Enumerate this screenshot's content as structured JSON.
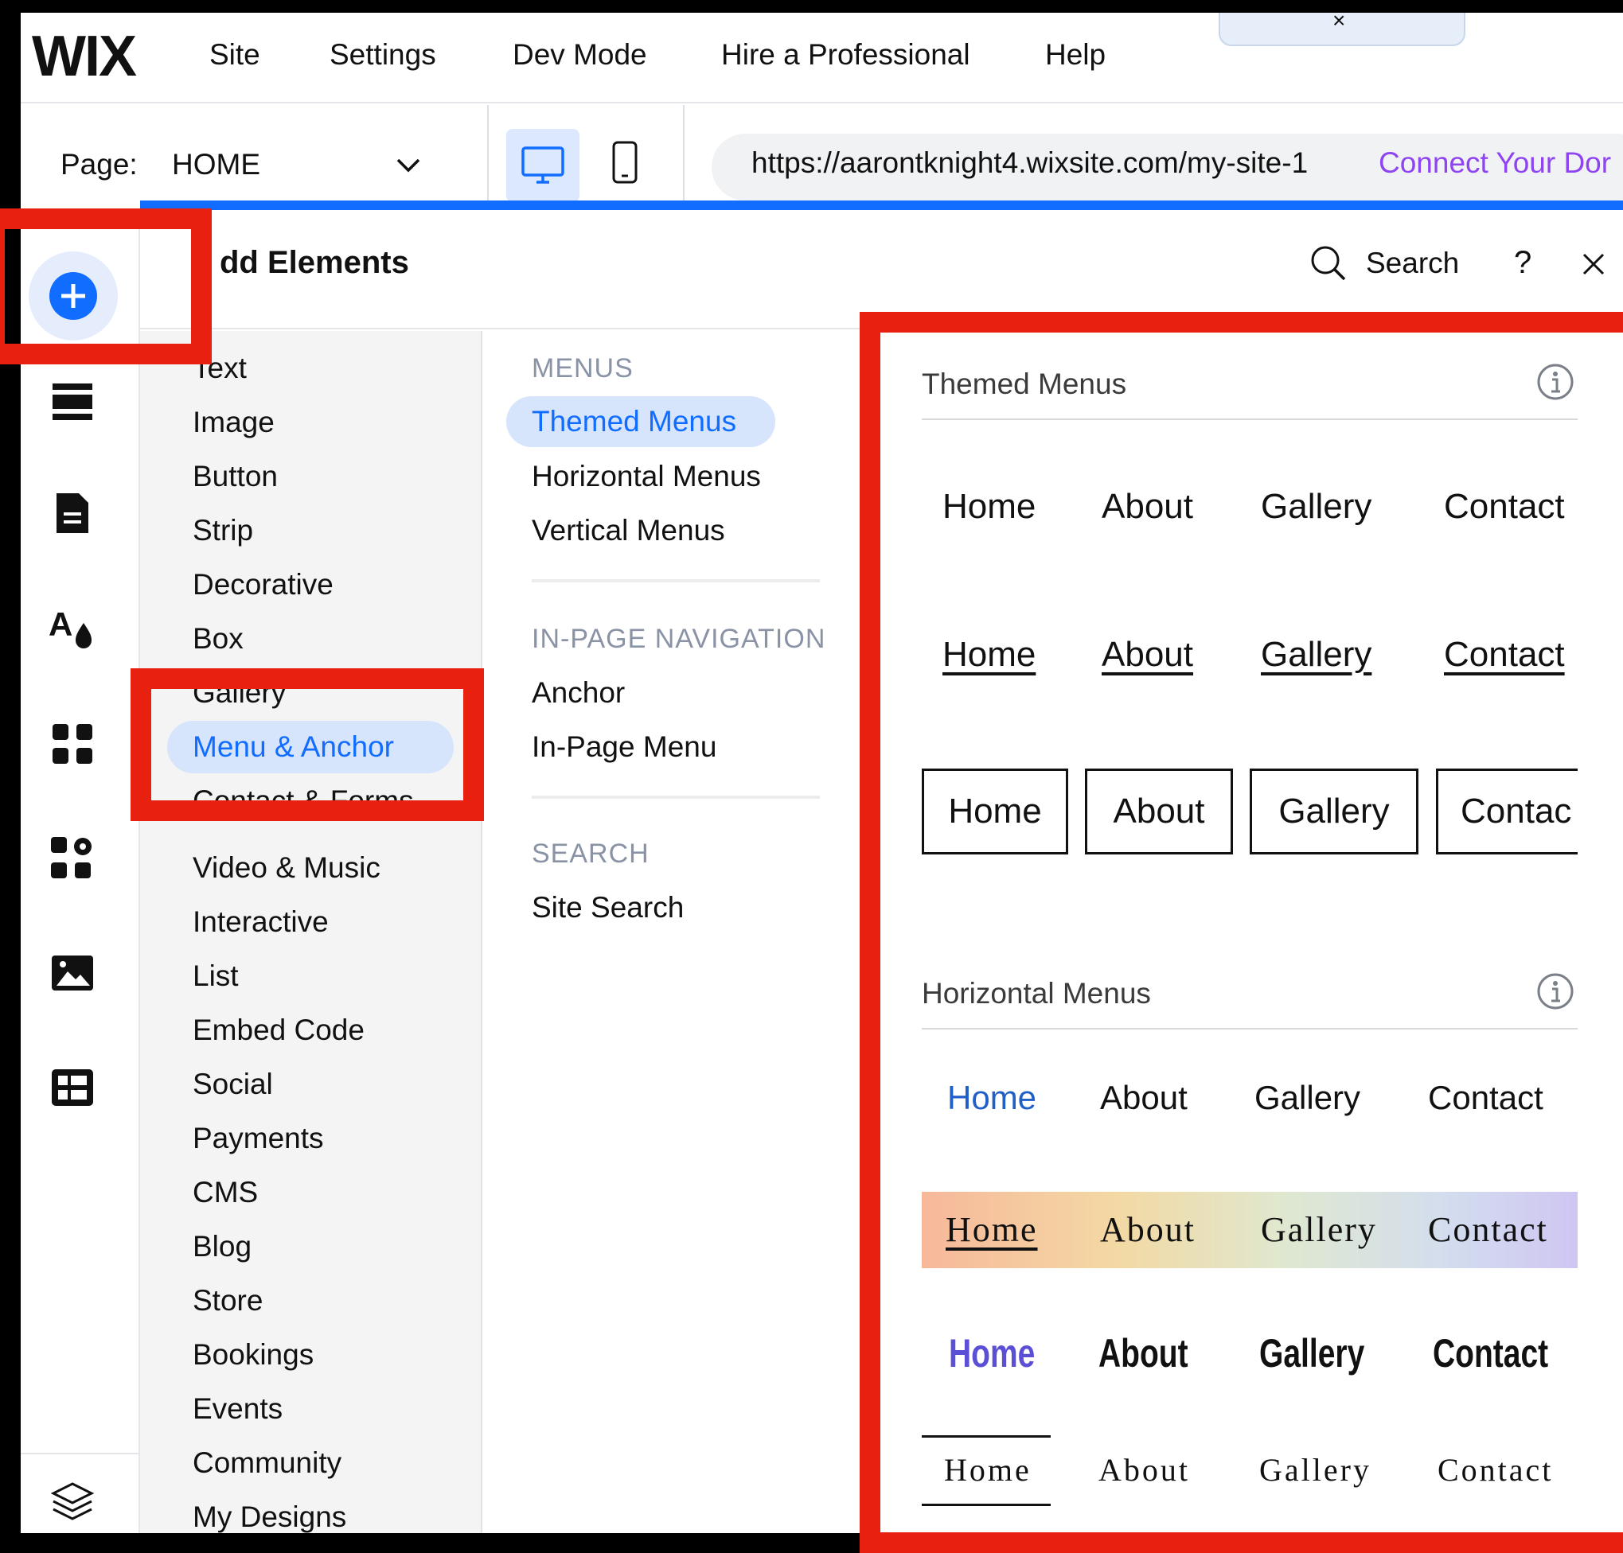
{
  "topbar": {
    "logo": "WIX",
    "menu": [
      "Site",
      "Settings",
      "Dev Mode",
      "Hire a Professional",
      "Help"
    ]
  },
  "toolbar": {
    "page_label": "Page:",
    "page_value": "HOME",
    "url": "https://aarontknight4.wixsite.com/my-site-1",
    "connect_domain": "Connect Your Dor"
  },
  "panel": {
    "title": "Add Elements",
    "title_visible": "dd Elements",
    "search_label": "Search",
    "help": "?"
  },
  "categories": [
    "Text",
    "Image",
    "Button",
    "Strip",
    "Decorative",
    "Box",
    "Gallery",
    "Menu & Anchor",
    "Contact & Forms",
    "Video & Music",
    "Interactive",
    "List",
    "Embed Code",
    "Social",
    "Payments",
    "CMS",
    "Blog",
    "Store",
    "Bookings",
    "Events",
    "Community",
    "My Designs"
  ],
  "subcategories": {
    "menus_heading": "MENUS",
    "menus": [
      "Themed Menus",
      "Horizontal Menus",
      "Vertical Menus"
    ],
    "inpage_heading": "IN-PAGE NAVIGATION",
    "inpage": [
      "Anchor",
      "In-Page Menu"
    ],
    "search_heading": "SEARCH",
    "search": [
      "Site Search"
    ]
  },
  "preview": {
    "themed_title": "Themed Menus",
    "horizontal_title": "Horizontal Menus",
    "items": [
      "Home",
      "About",
      "Gallery",
      "Contact"
    ],
    "boxed_last": "Contac"
  },
  "colors": {
    "accent": "#116dff",
    "highlight_bg": "#d6e4fc",
    "annotation_red": "#e8200f",
    "link_blue": "#1f5fc7",
    "purple": "#5b4fd6",
    "connect_purple": "#8e44f0"
  }
}
